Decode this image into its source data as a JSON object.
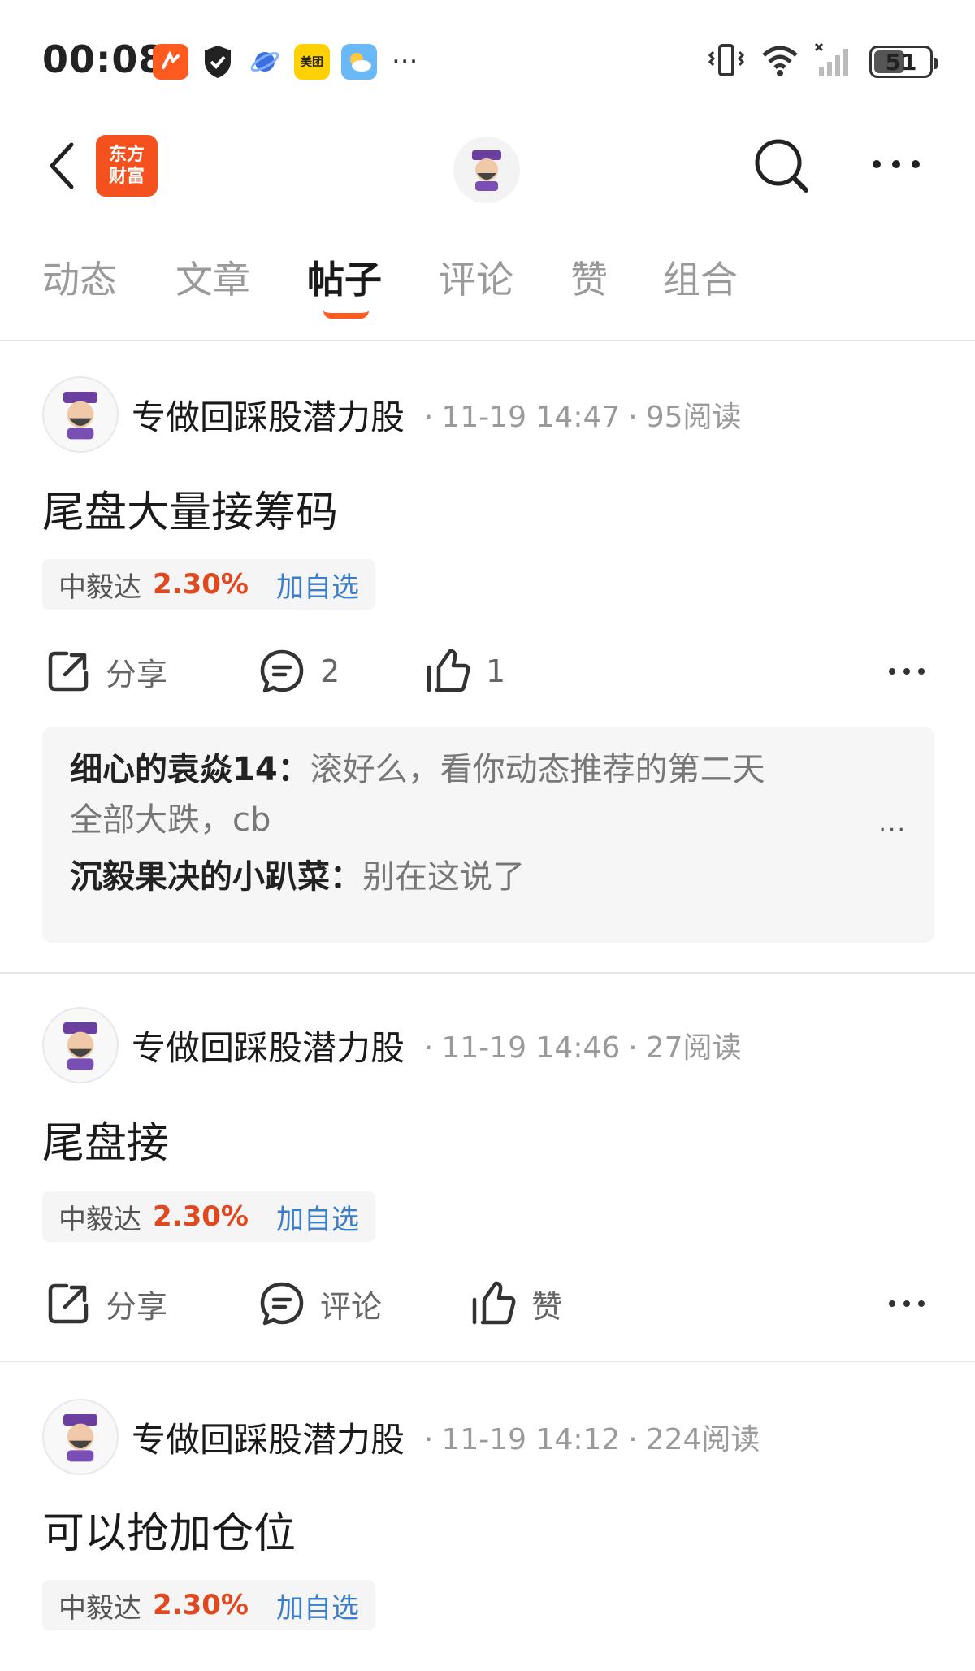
{
  "status_bar": {
    "time": "00:08",
    "apps": [
      "app-icon-1",
      "shield-icon",
      "planet-icon",
      "美团",
      "weather-icon"
    ],
    "overflow": "···",
    "battery": "51"
  },
  "header": {
    "brand": [
      "东方",
      "财富"
    ]
  },
  "tabs": [
    {
      "label": "动态"
    },
    {
      "label": "文章"
    },
    {
      "label": "帖子"
    },
    {
      "label": "评论"
    },
    {
      "label": "赞"
    },
    {
      "label": "组合"
    }
  ],
  "posts": [
    {
      "author": "专做回踩股潜力股",
      "time": "11-19 14:47",
      "reads": "95阅读",
      "title": "尾盘大量接筹码",
      "stock": {
        "name": "中毅达",
        "change": "2.30%",
        "add": "加自选"
      },
      "share": "分享",
      "comment": "2",
      "like": "1",
      "comments": [
        {
          "user": "细心的袁焱14",
          "sep": "：",
          "text": "滚好么，看你动态推荐的第二天"
        },
        {
          "user": "",
          "sep": "",
          "text": "全部大跌，cb"
        },
        {
          "user": "沉毅果决的小趴菜",
          "sep": "：",
          "text": "别在这说了"
        }
      ],
      "comment_more": "···"
    },
    {
      "author": "专做回踩股潜力股",
      "time": "11-19 14:46",
      "reads": "27阅读",
      "title": "尾盘接",
      "stock": {
        "name": "中毅达",
        "change": "2.30%",
        "add": "加自选"
      },
      "share": "分享",
      "comment": "评论",
      "like": "赞"
    },
    {
      "author": "专做回踩股潜力股",
      "time": "11-19 14:12",
      "reads": "224阅读",
      "title": "可以抢加仓位",
      "stock": {
        "name": "中毅达",
        "change": "2.30%",
        "add": "加自选"
      }
    }
  ],
  "colors": {
    "accent": "#ff5a1f",
    "stock_up": "#e0481f",
    "link": "#3a7dc9",
    "brand": "#f4511e"
  }
}
